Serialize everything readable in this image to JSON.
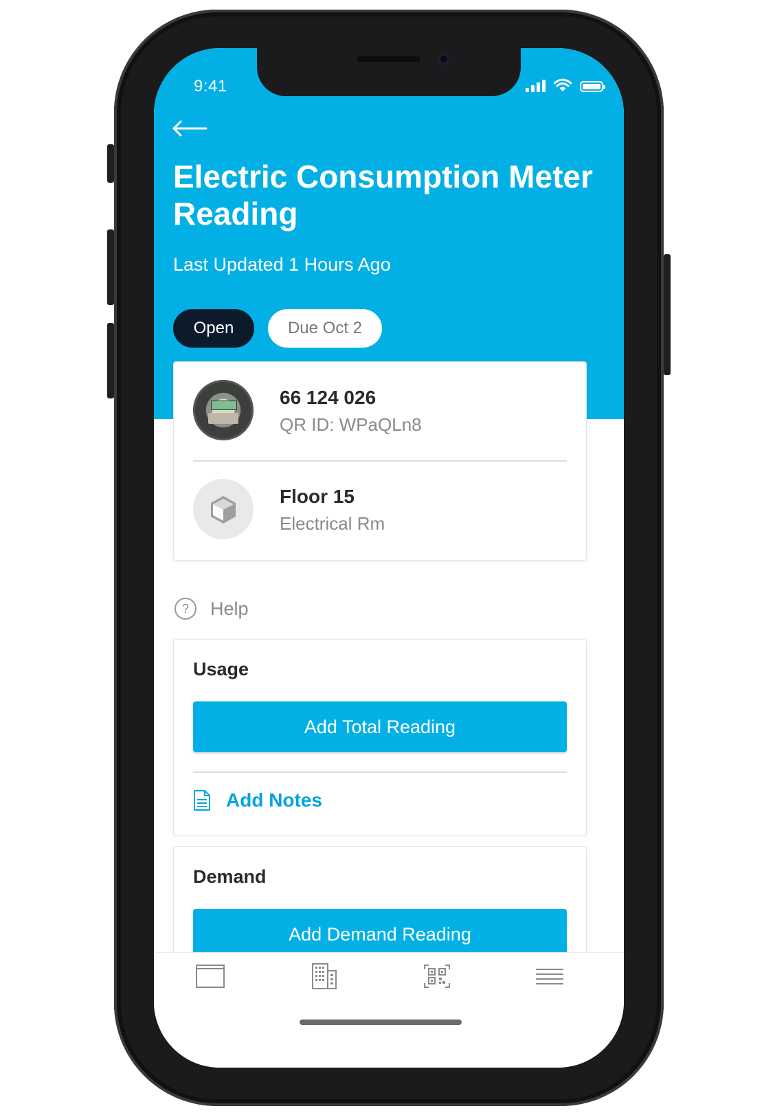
{
  "status_bar": {
    "time": "9:41"
  },
  "header": {
    "title": "Electric Consumption Meter Reading",
    "subtitle": "Last Updated 1 Hours Ago",
    "status_pill": "Open",
    "due_pill": "Due Oct 2"
  },
  "asset": {
    "meter_number": "66 124 026",
    "qr_id": "QR ID: WPaQLn8"
  },
  "location": {
    "floor": "Floor 15",
    "room": "Electrical Rm"
  },
  "help": {
    "label": "Help"
  },
  "usage": {
    "title": "Usage",
    "button_label": "Add Total Reading",
    "notes_label": "Add Notes"
  },
  "demand": {
    "title": "Demand",
    "button_label": "Add Demand Reading"
  },
  "colors": {
    "accent": "#03b0e5",
    "pill_dark": "#0b1b2b",
    "link": "#03a3de"
  },
  "icons": {
    "back": "arrow-left-icon",
    "help": "question-circle-icon",
    "notes": "document-icon",
    "tabs": [
      "window-icon",
      "building-icon",
      "qr-code-icon",
      "menu-icon"
    ]
  }
}
